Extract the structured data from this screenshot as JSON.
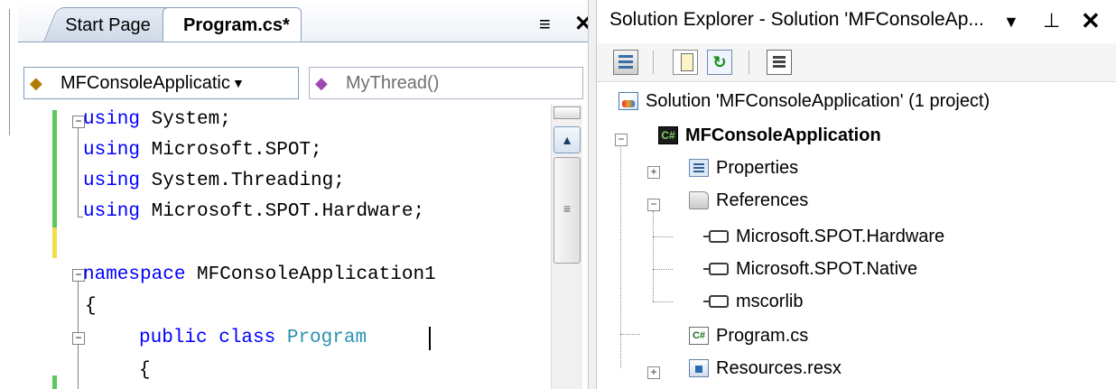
{
  "editor": {
    "tabs": [
      {
        "label": "Start Page",
        "active": false
      },
      {
        "label": "Program.cs*",
        "active": true
      }
    ],
    "tab_dropdown_icon": "dropdown-pin-icon",
    "tab_close_icon": "close-icon",
    "nav": {
      "class_combo": {
        "value": "MFConsoleApplicatic",
        "icon": "class-icon"
      },
      "member_combo": {
        "value": "MyThread()",
        "icon": "method-icon"
      }
    },
    "code_lines": [
      {
        "kw": "using",
        "rest": " System;"
      },
      {
        "kw": "using",
        "rest": " Microsoft.SPOT;"
      },
      {
        "kw": "using",
        "rest": " System.Threading;"
      },
      {
        "kw": "using",
        "rest": " Microsoft.SPOT.Hardware;"
      },
      {
        "kw": "",
        "rest": ""
      },
      {
        "kw": "namespace",
        "rest": " MFConsoleApplication1"
      },
      {
        "kw": "",
        "rest": "{"
      },
      {
        "kw": "public class",
        "type": "Program"
      },
      {
        "kw": "",
        "rest": "{"
      }
    ]
  },
  "solution_explorer": {
    "title": "Solution Explorer - Solution 'MFConsoleAp...",
    "toolbar": [
      "properties-icon",
      "show-all-files-icon",
      "refresh-icon",
      "view-class-diagram-icon"
    ],
    "tree": {
      "solution": "Solution 'MFConsoleApplication' (1 project)",
      "project": "MFConsoleApplication",
      "properties": "Properties",
      "references": "References",
      "ref_items": [
        "Microsoft.SPOT.Hardware",
        "Microsoft.SPOT.Native",
        "mscorlib"
      ],
      "program_file": "Program.cs",
      "resources_file": "Resources.resx"
    }
  },
  "colors": {
    "keyword": "#0000ff",
    "type": "#2b91af",
    "change_saved": "#5ac85a",
    "change_unsaved": "#f0e050"
  }
}
